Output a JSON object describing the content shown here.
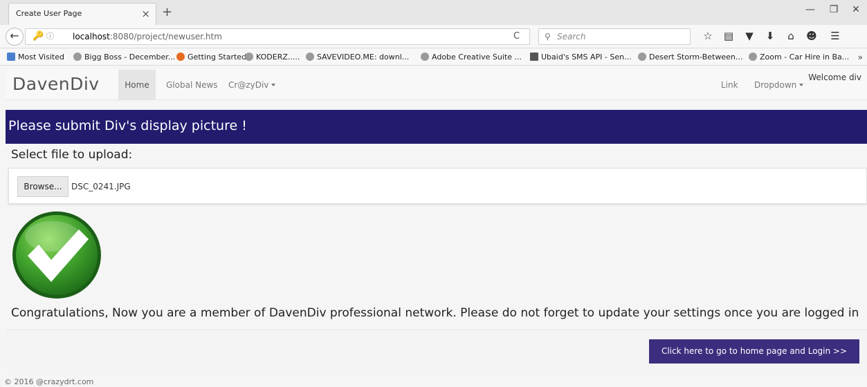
{
  "browser": {
    "tab_title": "Create User Page",
    "tab_close": "×",
    "new_tab": "+",
    "window_minimize": "—",
    "window_restore": "❐",
    "window_close": "✕",
    "back": "←",
    "url_host": "localhost",
    "url_rest": ":8080/project/newuser.htm",
    "reload": "C",
    "search_placeholder": "Search",
    "icons": [
      "star-icon",
      "reading-list-icon",
      "pocket-icon",
      "download-icon",
      "home-icon",
      "emoji-icon",
      "menu-icon"
    ]
  },
  "bookmarks": [
    {
      "label": "Most Visited",
      "icon": "blue"
    },
    {
      "label": "Bigg Boss - December...",
      "icon": "globe"
    },
    {
      "label": "Getting Started",
      "icon": "ff"
    },
    {
      "label": "KODERZ.....",
      "icon": "globe"
    },
    {
      "label": "SAVEVIDEO.ME: downl...",
      "icon": "globe"
    },
    {
      "label": "Adobe Creative Suite ...",
      "icon": "globe"
    },
    {
      "label": "Ubaid's SMS API - Sen...",
      "icon": "photo"
    },
    {
      "label": "Desert Storm-Between...",
      "icon": "globe"
    },
    {
      "label": "Zoom - Car Hire in Ba...",
      "icon": "globe"
    }
  ],
  "bookmarks_more": "»",
  "site_nav": {
    "brand": "DavenDiv",
    "home": "Home",
    "global_news": "Global News",
    "crazydiv": "Cr@zyDiv",
    "link": "Link",
    "dropdown": "Dropdown",
    "welcome": "Welcome div"
  },
  "banner": {
    "text": "Please submit Div's display picture !"
  },
  "upload": {
    "label": "Select file to upload:",
    "browse": "Browse...",
    "file_name": "DSC_0241.JPG"
  },
  "message": "Congratulations, Now you are a member of DavenDiv professional network. Please do not forget to update your settings once you are logged in",
  "login_button": "Click here to go to home page and Login >>",
  "copyright": "© 2016 @crazydrt.com",
  "colors": {
    "banner": "#221b6e",
    "button": "#3d2d7e",
    "check_green": "#3fa02c"
  }
}
